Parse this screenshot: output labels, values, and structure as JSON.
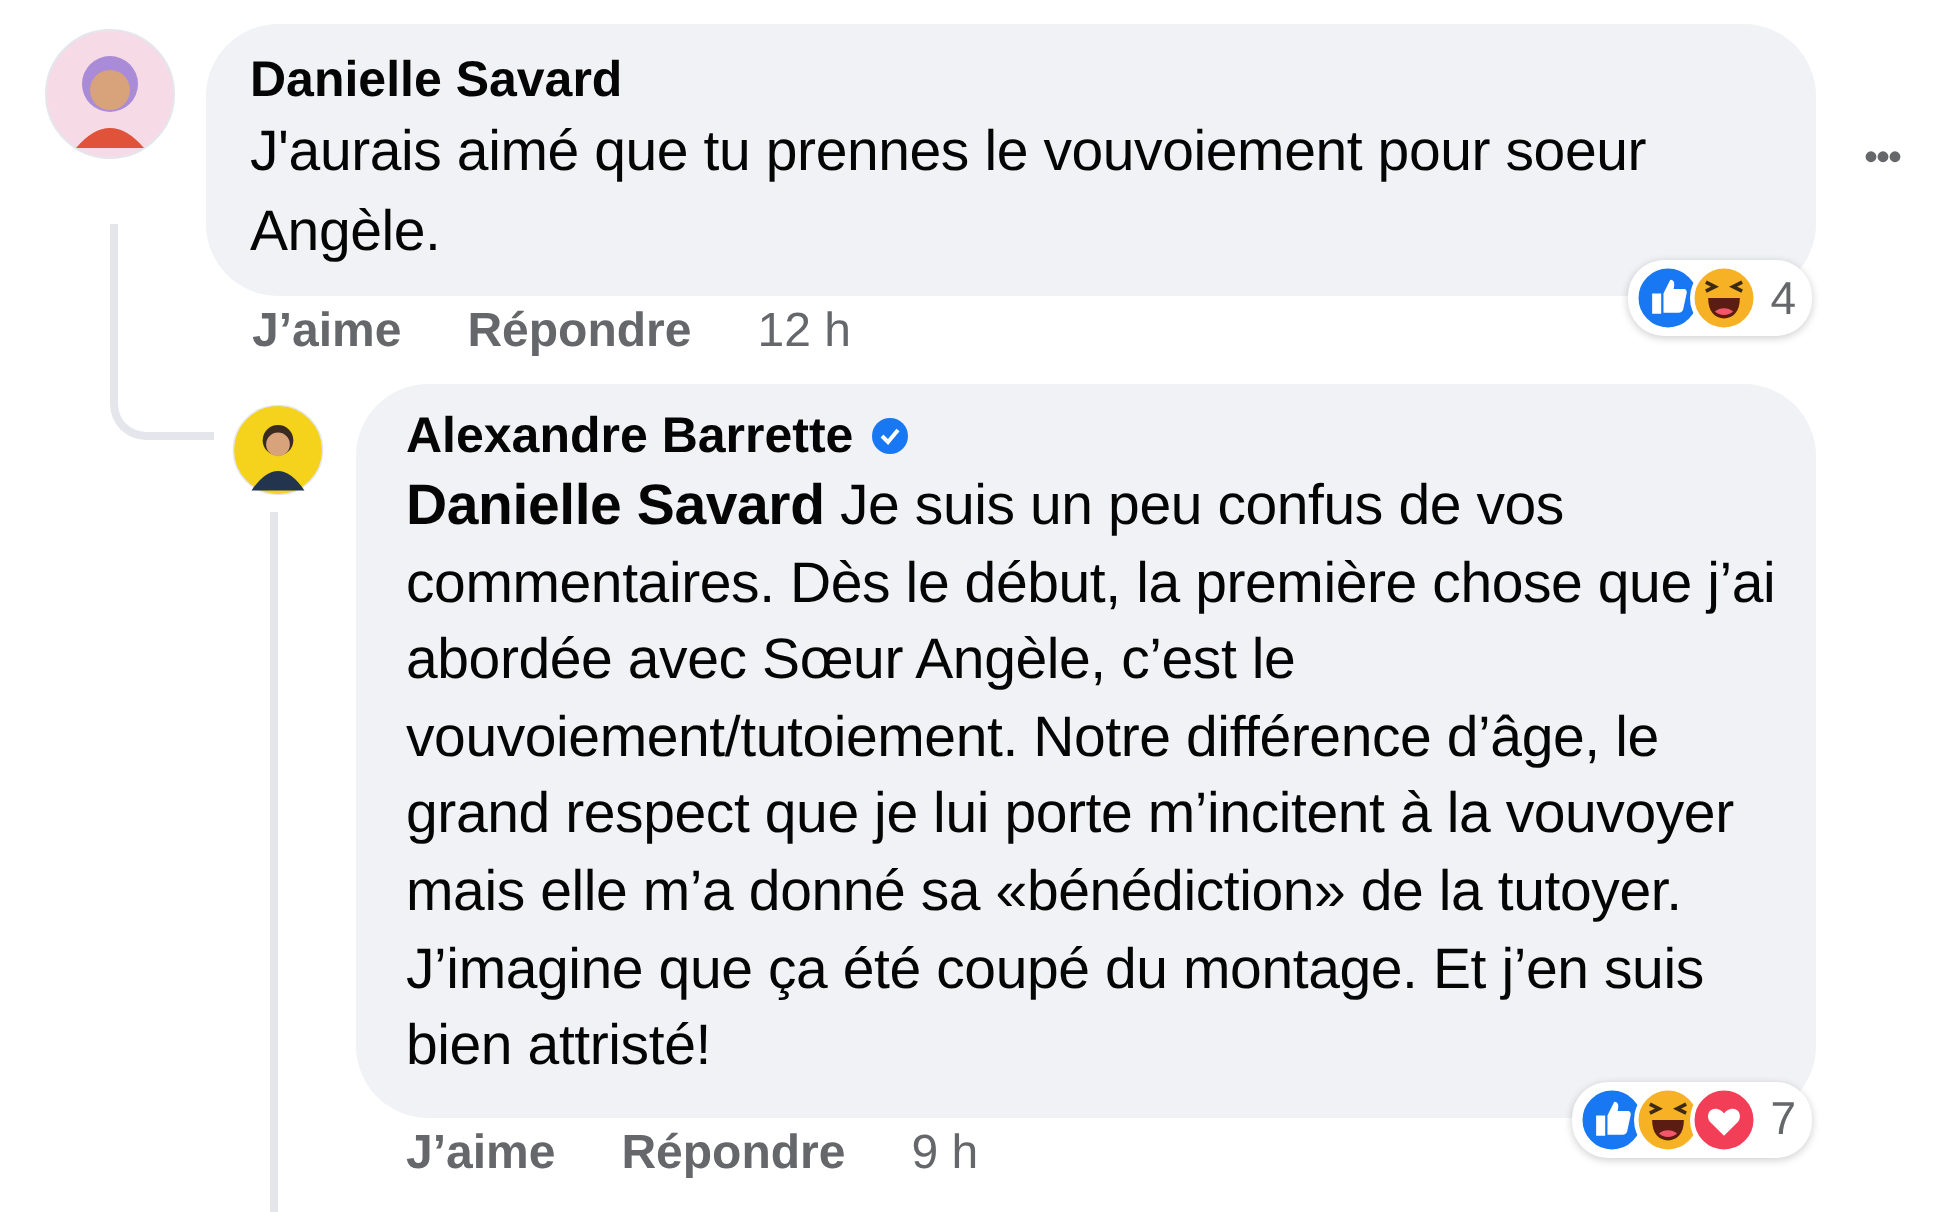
{
  "comments": [
    {
      "author": "Danielle Savard",
      "body": "J'aurais aimé que tu prennes le vouvoiement pour soeur Angèle.",
      "reactions": [
        {
          "kind": "like"
        },
        {
          "kind": "haha"
        }
      ],
      "reaction_count": "4",
      "like_label": "J’aime",
      "reply_label": "Répondre",
      "time": "12 h",
      "more": "•••",
      "replies": [
        {
          "author": "Alexandre Barrette",
          "verified": true,
          "body": "**Danielle Savard** Je suis un peu confus de vos commentaires. Dès le début, la première chose que j’ai abordée avec Sœur Angèle, c’est le vouvoiement/tutoiement. Notre différence d’âge, le grand respect que je lui porte m’incitent à la vouvoyer mais elle m’a donné sa «bénédiction» de la tutoyer. J’imagine que ça été coupé du montage. Et j’en suis bien attristé!",
          "reactions": [
            {
              "kind": "like"
            },
            {
              "kind": "haha"
            },
            {
              "kind": "love"
            }
          ],
          "reaction_count": "7",
          "like_label": "J’aime",
          "reply_label": "Répondre",
          "time": "9 h"
        }
      ]
    }
  ]
}
